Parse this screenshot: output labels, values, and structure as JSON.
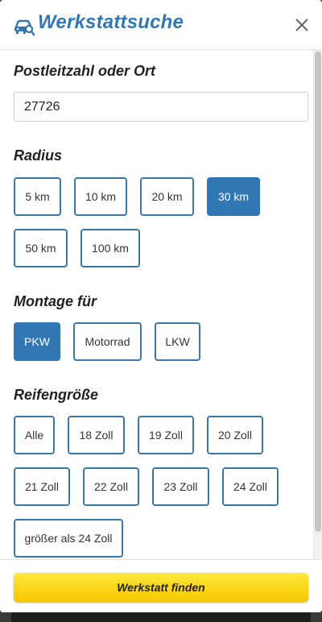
{
  "header": {
    "title": "Werkstattsuche",
    "icon": "car-search-icon",
    "close_icon": "close-icon"
  },
  "location": {
    "label": "Postleitzahl oder Ort",
    "value": "27726"
  },
  "radius": {
    "label": "Radius",
    "options": [
      "5 km",
      "10 km",
      "20 km",
      "30 km",
      "50 km",
      "100 km"
    ],
    "selected": "30 km"
  },
  "mount": {
    "label": "Montage für",
    "options": [
      "PKW",
      "Motorrad",
      "LKW"
    ],
    "selected": "PKW"
  },
  "tire_size": {
    "label": "Reifengröße",
    "options": [
      "Alle",
      "18 Zoll",
      "19 Zoll",
      "20 Zoll",
      "21 Zoll",
      "22 Zoll",
      "23 Zoll",
      "24 Zoll",
      "größer als 24 Zoll"
    ]
  },
  "footer": {
    "button_label": "Werkstatt finden"
  },
  "colors": {
    "accent": "#3077b3",
    "chip_border": "#3a78a9",
    "button": "#ffd81a"
  }
}
